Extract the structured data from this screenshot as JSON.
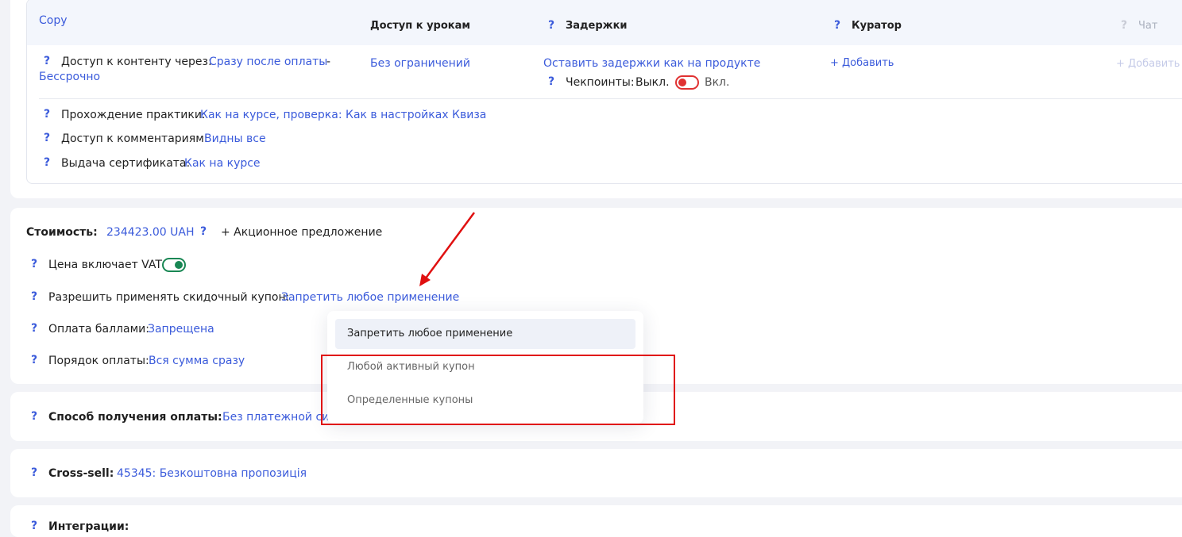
{
  "access": {
    "copy_label": "Copy",
    "headers": {
      "lessons": "Доступ к урокам",
      "delays": "Задержки",
      "curator": "Куратор",
      "chat": "Чат"
    },
    "content_access_label": "Доступ к контенту через:",
    "content_access_value": "Сразу после оплаты",
    "content_access_sep": "-",
    "content_access_duration": "Бессрочно",
    "lessons_value": "Без ограничений",
    "delays_value": "Оставить задержки как на продукте",
    "checkpoints_label": "Чекпоинты:",
    "checkpoints_off": "Выкл.",
    "checkpoints_on": "Вкл.",
    "curator_add": "+ Добавить",
    "chat_add": "+ Добавить",
    "practice_label": "Прохождение практики:",
    "practice_value": "Как на курсе, проверка: Как в настройках Квиза",
    "comments_label": "Доступ к комментариям:",
    "comments_value": "Видны все",
    "certificate_label": "Выдача сертификата:",
    "certificate_value": "Как на курсе"
  },
  "pricing": {
    "cost_label": "Стоимость:",
    "cost_value": "234423.00 UAH",
    "promo_label": "+ Акционное предложение",
    "vat_label": "Цена включает VAT",
    "vat_enabled": true,
    "coupon_label": "Разрешить применять скидочный купон:",
    "coupon_value": "Запретить любое применение",
    "points_label": "Оплата баллами:",
    "points_value": "Запрещена",
    "order_label": "Порядок оплаты:",
    "order_value": "Вся сумма сразу"
  },
  "coupon_dropdown": {
    "options": [
      "Запретить любое применение",
      "Любой активный купон",
      "Определенные купоны"
    ],
    "selected_index": 0
  },
  "payment_method": {
    "label": "Способ получения оплаты:",
    "value": "Без платежной систе"
  },
  "cross_sell": {
    "label": "Cross-sell:",
    "value": "45345: Безкоштовна пропозиція"
  },
  "integrations": {
    "label": "Интеграции:"
  },
  "help_glyph": "?",
  "colors": {
    "accent": "#3b5bdb",
    "annotation": "#e01010",
    "toggle_off": "#e03131",
    "toggle_on": "#198754"
  }
}
